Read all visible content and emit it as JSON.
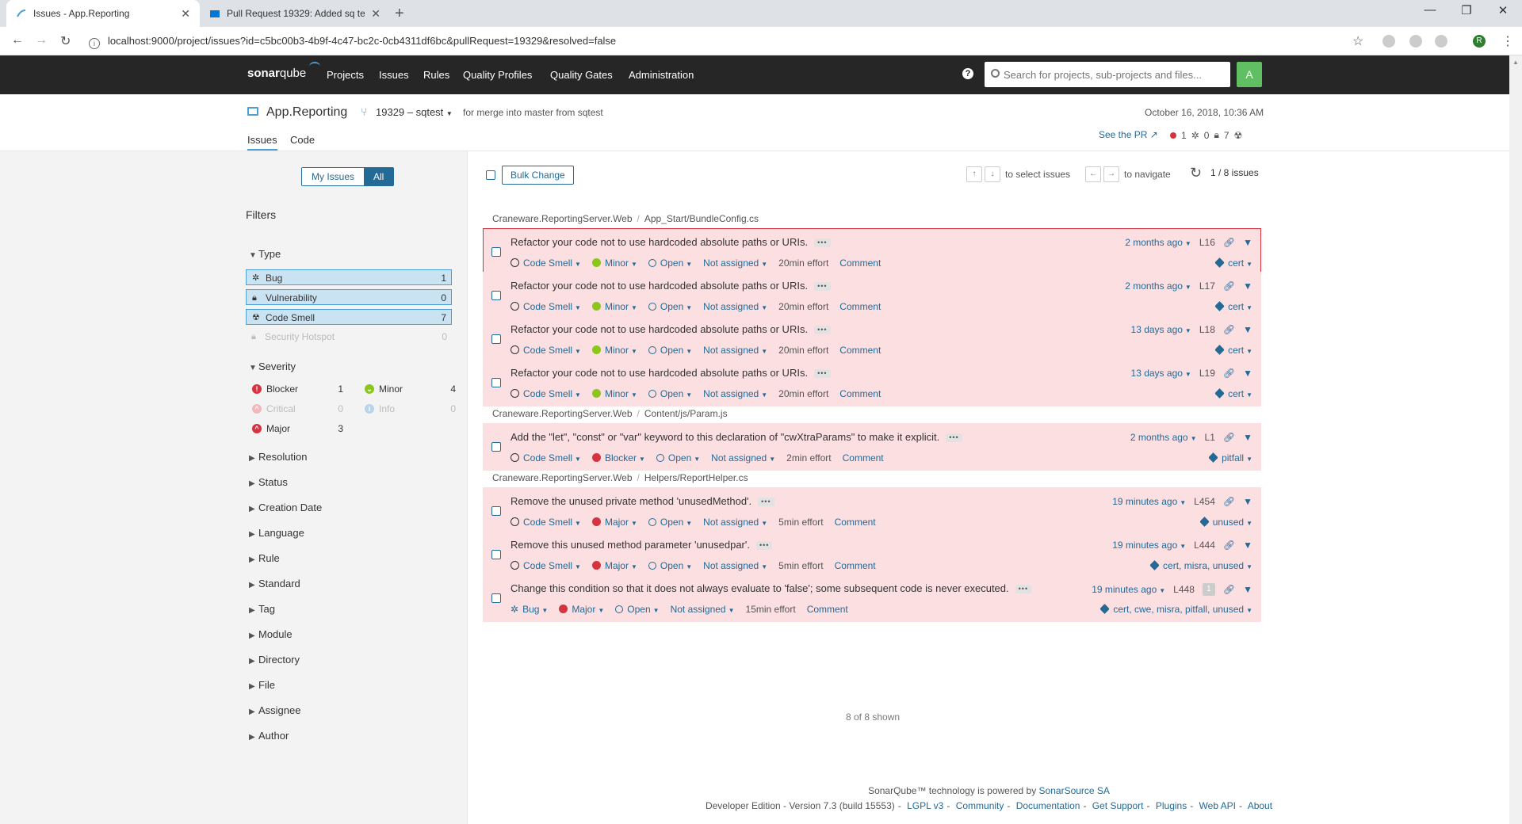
{
  "browser": {
    "tabs": [
      {
        "title": "Issues - App.Reporting"
      },
      {
        "title": "Pull Request 19329: Added sq te"
      }
    ],
    "url": "localhost:9000/project/issues?id=c5bc00b3-4b9f-4c47-bc2c-0cb4311df6bc&pullRequest=19329&resolved=false",
    "profile_initial": "R"
  },
  "nav": {
    "logo_sonar": "sonar",
    "logo_qube": "qube",
    "items": [
      "Projects",
      "Issues",
      "Rules",
      "Quality Profiles",
      "Quality Gates",
      "Administration"
    ],
    "search_placeholder": "Search for projects, sub-projects and files...",
    "user_initial": "A"
  },
  "project": {
    "name": "App.Reporting",
    "branch": "19329 – sqtest",
    "merge_info": "for merge into master from sqtest",
    "date": "October 16, 2018, 10:36 AM",
    "see_pr": "See the PR",
    "status_bugs": "1",
    "status_vulns": "0",
    "status_smells": "7",
    "tabs": [
      "Issues",
      "Code"
    ]
  },
  "sidebar": {
    "scope": [
      "My Issues",
      "All"
    ],
    "filters_title": "Filters",
    "type_title": "Type",
    "types": [
      {
        "label": "Bug",
        "count": "1"
      },
      {
        "label": "Vulnerability",
        "count": "0"
      },
      {
        "label": "Code Smell",
        "count": "7"
      },
      {
        "label": "Security Hotspot",
        "count": "0"
      }
    ],
    "severity_title": "Severity",
    "severities": [
      {
        "label": "Blocker",
        "count": "1"
      },
      {
        "label": "Minor",
        "count": "4"
      },
      {
        "label": "Critical",
        "count": "0"
      },
      {
        "label": "Info",
        "count": "0"
      },
      {
        "label": "Major",
        "count": "3"
      }
    ],
    "collapsed": [
      "Resolution",
      "Status",
      "Creation Date",
      "Language",
      "Rule",
      "Standard",
      "Tag",
      "Module",
      "Directory",
      "File",
      "Assignee",
      "Author"
    ]
  },
  "toolbar": {
    "bulk_change": "Bulk Change",
    "select_hint": "to select issues",
    "navigate_hint": "to navigate",
    "page_count": "1 / 8 issues",
    "key_up": "↑",
    "key_down": "↓",
    "key_left": "←",
    "key_right": "→"
  },
  "components": [
    {
      "project": "Craneware.ReportingServer.Web",
      "file": "App_Start/BundleConfig.cs"
    },
    {
      "project": "Craneware.ReportingServer.Web",
      "file": "Content/js/Param.js"
    },
    {
      "project": "Craneware.ReportingServer.Web",
      "file": "Helpers/ReportHelper.cs"
    }
  ],
  "issues": [
    {
      "message": "Refactor your code not to use hardcoded absolute paths or URIs.",
      "type": "Code Smell",
      "severity": "Minor",
      "status": "Open",
      "assignee": "Not assigned",
      "effort": "20min effort",
      "comment": "Comment",
      "age": "2 months ago",
      "line": "L16",
      "tags": "cert"
    },
    {
      "message": "Refactor your code not to use hardcoded absolute paths or URIs.",
      "type": "Code Smell",
      "severity": "Minor",
      "status": "Open",
      "assignee": "Not assigned",
      "effort": "20min effort",
      "comment": "Comment",
      "age": "2 months ago",
      "line": "L17",
      "tags": "cert"
    },
    {
      "message": "Refactor your code not to use hardcoded absolute paths or URIs.",
      "type": "Code Smell",
      "severity": "Minor",
      "status": "Open",
      "assignee": "Not assigned",
      "effort": "20min effort",
      "comment": "Comment",
      "age": "13 days ago",
      "line": "L18",
      "tags": "cert"
    },
    {
      "message": "Refactor your code not to use hardcoded absolute paths or URIs.",
      "type": "Code Smell",
      "severity": "Minor",
      "status": "Open",
      "assignee": "Not assigned",
      "effort": "20min effort",
      "comment": "Comment",
      "age": "13 days ago",
      "line": "L19",
      "tags": "cert"
    },
    {
      "message": "Add the \"let\", \"const\" or \"var\" keyword to this declaration of \"cwXtraParams\" to make it explicit.",
      "type": "Code Smell",
      "severity": "Blocker",
      "status": "Open",
      "assignee": "Not assigned",
      "effort": "2min effort",
      "comment": "Comment",
      "age": "2 months ago",
      "line": "L1",
      "tags": "pitfall"
    },
    {
      "message": "Remove the unused private method 'unusedMethod'.",
      "type": "Code Smell",
      "severity": "Major",
      "status": "Open",
      "assignee": "Not assigned",
      "effort": "5min effort",
      "comment": "Comment",
      "age": "19 minutes ago",
      "line": "L454",
      "tags": "unused"
    },
    {
      "message": "Remove this unused method parameter 'unusedpar'.",
      "type": "Code Smell",
      "severity": "Major",
      "status": "Open",
      "assignee": "Not assigned",
      "effort": "5min effort",
      "comment": "Comment",
      "age": "19 minutes ago",
      "line": "L444",
      "tags": "cert, misra, unused"
    },
    {
      "message": "Change this condition so that it does not always evaluate to 'false'; some subsequent code is never executed.",
      "type": "Bug",
      "severity": "Major",
      "status": "Open",
      "assignee": "Not assigned",
      "effort": "15min effort",
      "comment": "Comment",
      "age": "19 minutes ago",
      "line": "L448",
      "flows": "1",
      "tags": "cert, cwe, misra, pitfall, unused"
    }
  ],
  "shown": "8 of 8 shown",
  "footer": {
    "powered_prefix": "SonarQube™ technology is powered by",
    "powered_link": "SonarSource SA",
    "edition": "Developer Edition - Version 7.3 (build 15553)",
    "links": [
      "LGPL v3",
      "Community",
      "Documentation",
      "Get Support",
      "Plugins",
      "Web API",
      "About"
    ]
  },
  "colors": {
    "blocker": "#d4333f",
    "minor": "#8ac71a",
    "major": "#d4333f",
    "accent": "#236a97",
    "issue_bg": "#fcdfe1"
  }
}
